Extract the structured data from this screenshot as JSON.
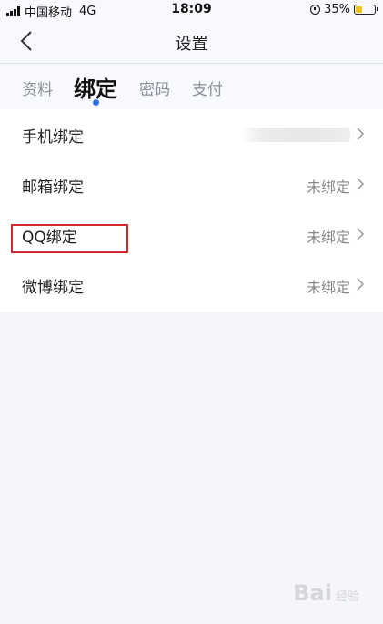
{
  "status_bar": {
    "carrier": "中国移动",
    "network": "4G",
    "time": "18:09",
    "battery": "35%",
    "battery_level": 0.35
  },
  "header": {
    "title": "设置"
  },
  "tabs": [
    {
      "label": "资料",
      "active": false
    },
    {
      "label": "绑定",
      "active": true
    },
    {
      "label": "密码",
      "active": false
    },
    {
      "label": "支付",
      "active": false
    }
  ],
  "bindings": [
    {
      "label": "手机绑定",
      "value": ""
    },
    {
      "label": "邮箱绑定",
      "value": "未绑定"
    },
    {
      "label": "QQ绑定",
      "value": "未绑定"
    },
    {
      "label": "微博绑定",
      "value": "未绑定"
    }
  ],
  "watermark": {
    "brand": "Bai",
    "sub": "经验"
  },
  "colors": {
    "accent": "#2f6fe8",
    "highlight": "#d62a2a",
    "battery": "#f1c40f"
  }
}
